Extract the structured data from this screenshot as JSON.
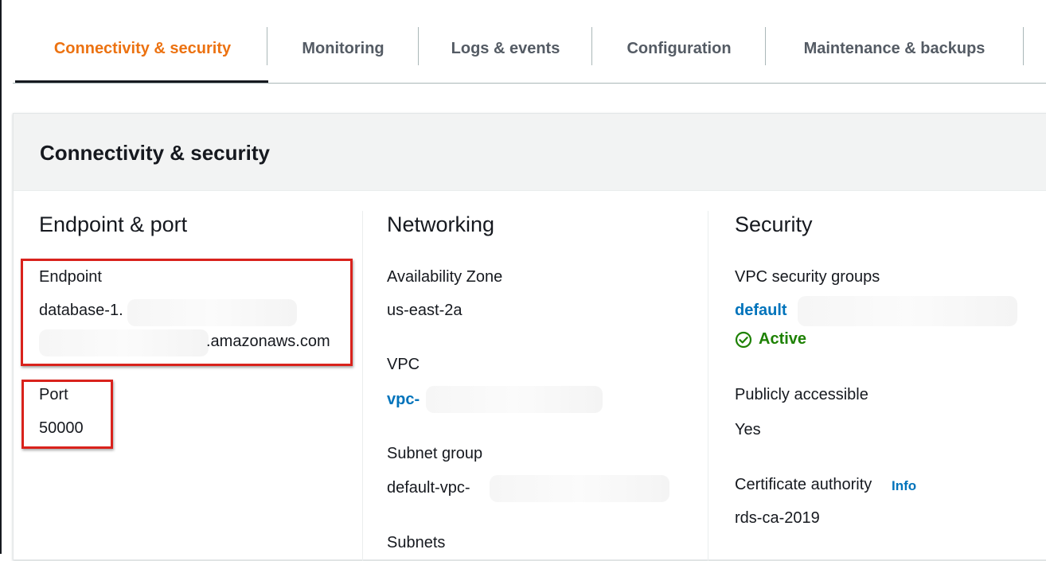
{
  "tabs": [
    {
      "label": "Connectivity & security",
      "active": true
    },
    {
      "label": "Monitoring",
      "active": false
    },
    {
      "label": "Logs & events",
      "active": false
    },
    {
      "label": "Configuration",
      "active": false
    },
    {
      "label": "Maintenance & backups",
      "active": false
    }
  ],
  "panel": {
    "title": "Connectivity & security",
    "endpoint_port": {
      "title": "Endpoint & port",
      "endpoint_label": "Endpoint",
      "endpoint_line1": "database-1.",
      "endpoint_line2": ".amazonaws.com",
      "port_label": "Port",
      "port_value": "50000"
    },
    "networking": {
      "title": "Networking",
      "az_label": "Availability Zone",
      "az_value": "us-east-2a",
      "vpc_label": "VPC",
      "vpc_value": "vpc-",
      "subnet_group_label": "Subnet group",
      "subnet_group_value": "default-vpc-",
      "subnets_label": "Subnets"
    },
    "security": {
      "title": "Security",
      "sg_label": "VPC security groups",
      "sg_value": "default",
      "sg_status": "Active",
      "public_label": "Publicly accessible",
      "public_value": "Yes",
      "ca_label": "Certificate authority",
      "ca_info": "Info",
      "ca_value": "rds-ca-2019"
    }
  },
  "colors": {
    "accent_active_tab": "#ec7211",
    "link": "#0073bb",
    "status_active": "#1d8102",
    "highlight_box": "#d9221c"
  },
  "icons": {
    "status": "check-circle-icon"
  }
}
